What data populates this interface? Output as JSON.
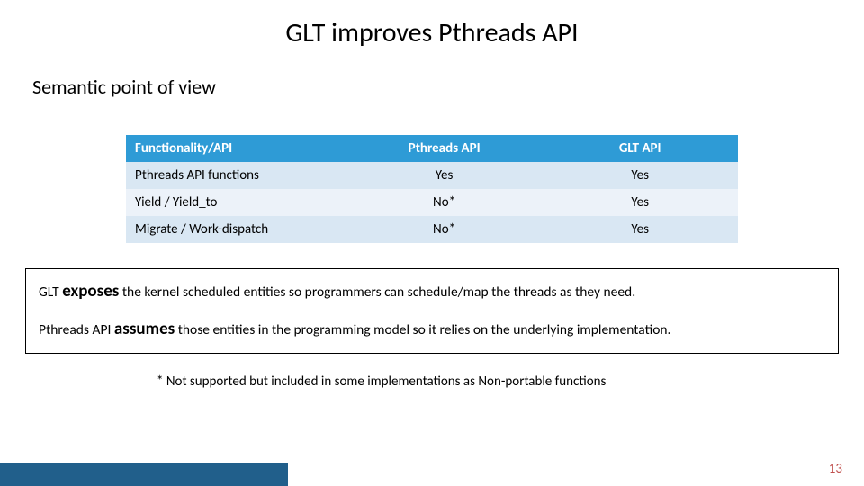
{
  "title": "GLT improves Pthreads API",
  "subtitle": "Semantic point of view",
  "table": {
    "headers": [
      "Functionality/API",
      "Pthreads API",
      "GLT API"
    ],
    "rows": [
      {
        "func": "Pthreads API functions",
        "pthreads": "Yes",
        "glt": "Yes"
      },
      {
        "func": "Yield / Yield_to",
        "pthreads": "No*",
        "glt": "Yes"
      },
      {
        "func": "Migrate / Work-dispatch",
        "pthreads": "No*",
        "glt": "Yes"
      }
    ]
  },
  "box": {
    "line1_pre": "GLT ",
    "line1_em": "exposes",
    "line1_post": " the kernel scheduled entities so programmers can schedule/map the threads as they need.",
    "line2_pre": "Pthreads API ",
    "line2_em": "assumes",
    "line2_post": " those entities in the programming model so it relies on the underlying implementation."
  },
  "footnote": "* Not supported but included in some implementations as Non-portable functions",
  "page_number": "13"
}
